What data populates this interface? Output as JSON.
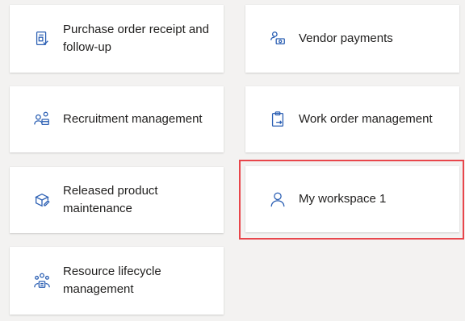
{
  "tiles": [
    {
      "label": "Purchase order receipt and follow-up",
      "icon": "purchase-order-icon"
    },
    {
      "label": "Vendor payments",
      "icon": "vendor-payments-icon"
    },
    {
      "label": "Recruitment management",
      "icon": "recruitment-icon"
    },
    {
      "label": "Work order management",
      "icon": "clipboard-icon"
    },
    {
      "label": "Released product maintenance",
      "icon": "product-box-icon"
    },
    {
      "label": "My workspace 1",
      "icon": "person-icon",
      "selected": true
    },
    {
      "label": "Resource lifecycle management",
      "icon": "resource-lifecycle-icon"
    }
  ],
  "colors": {
    "icon": "#2b5fb3",
    "highlight": "#e8464b",
    "background": "#f3f2f1"
  }
}
